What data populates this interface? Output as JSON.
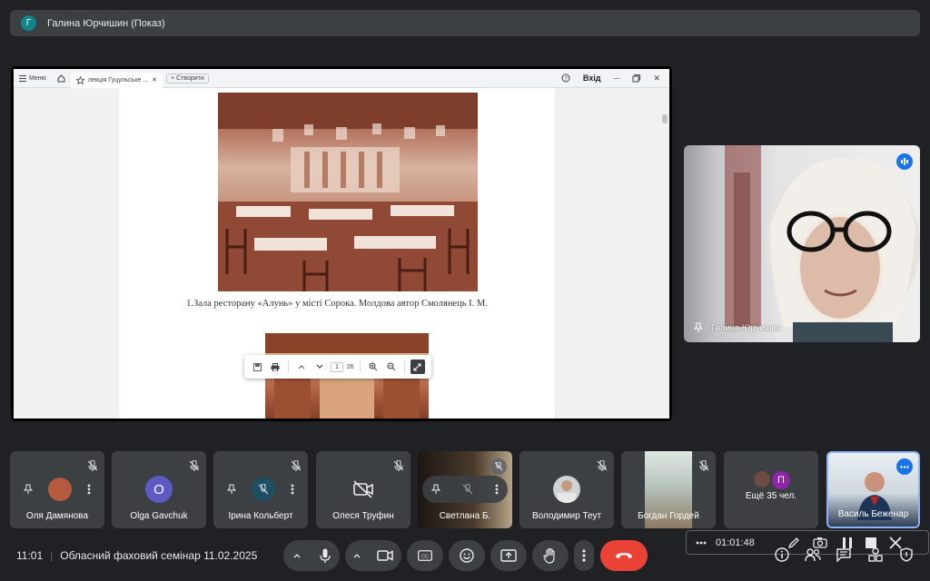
{
  "presenter": {
    "initial": "Г",
    "name": "Галина Юрчишин (Показ)"
  },
  "browser": {
    "menu_label": "Меню",
    "tab_title": "лекція Гуцульське ...",
    "new_button": "+ Створити",
    "login": "Вхід"
  },
  "document": {
    "caption": "1.Зала ресторану «Алунь» у місті Сорока. Молдова автор Смолянець І. М.",
    "page_current": "1",
    "page_total": "26"
  },
  "speaker": {
    "name": "Галина Юрчишин"
  },
  "participants": [
    {
      "name": "Оля Дамянова"
    },
    {
      "name": "Olga Gavchuk",
      "initial": "O",
      "color": "#5e5ac4"
    },
    {
      "name": "Ірина Кольберт"
    },
    {
      "name": "Олеся Труфин"
    },
    {
      "name": "Светлана Б."
    },
    {
      "name": "Володимир Теут"
    },
    {
      "name": "Богдан Гордей"
    },
    {
      "name": "Ещё 35 чел.",
      "initial": "П",
      "color": "#8e24aa"
    },
    {
      "name": "Василь Беженар"
    }
  ],
  "recording": {
    "timer": "01:01:48"
  },
  "meeting": {
    "time": "11:01",
    "title": "Обласний фаховий семінар 11.02.2025"
  },
  "colors": {
    "end_call": "#ea4335",
    "accent": "#8ab4f8",
    "tile": "#3c4043"
  }
}
